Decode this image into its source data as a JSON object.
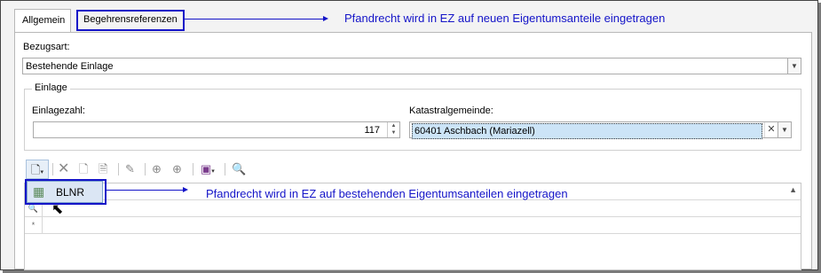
{
  "tabs": [
    {
      "label": "Allgemein",
      "active": true
    },
    {
      "label": "Begehrensreferenzen",
      "active": false
    }
  ],
  "annotations": {
    "tab_note": "Pfandrecht wird in EZ auf neuen Eigentumsanteile eingetragen",
    "menu_note": "Pfandrecht wird in EZ auf bestehenden Eigentumsanteilen eingetragen",
    "color": "#1414c8"
  },
  "form": {
    "bezugsart_label": "Bezugsart:",
    "bezugsart_value": "Bestehende Einlage",
    "einlage_group_title": "Einlage",
    "einlagezahl_label": "Einlagezahl:",
    "einlagezahl_value": "117",
    "katastral_label": "Katastralgemeinde:",
    "katastral_value": "60401 Aschbach (Mariazell)"
  },
  "toolbar": {
    "icons": [
      "new-document-icon",
      "delete-icon",
      "add-row-icon",
      "copy-icon",
      "edit-icon",
      "move-up-icon",
      "move-down-icon",
      "save-dropdown-icon",
      "search-document-icon"
    ]
  },
  "dropdown_menu": {
    "items": [
      {
        "label": "BLNR",
        "icon": "grid-add-icon"
      }
    ]
  },
  "grid": {
    "row_indicators": [
      "🔍",
      "*"
    ]
  }
}
